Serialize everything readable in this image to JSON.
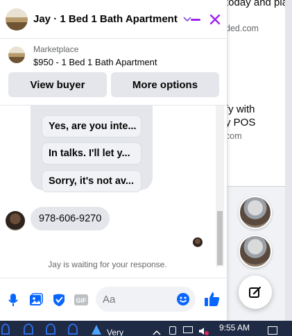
{
  "background": {
    "snippets": [
      "today and play",
      "ded.com",
      "fy with",
      "y POS",
      "com"
    ]
  },
  "chat": {
    "title": "Jay · 1 Bed 1 Bath Apartment",
    "chevron_icon": "chevron-down-icon",
    "accent": "#a020f0",
    "listing": {
      "category": "Marketplace",
      "title": "$950 - 1 Bed 1 Bath Apartment"
    },
    "buttons": {
      "view_buyer": "View buyer",
      "more_options": "More options"
    },
    "quick_replies": [
      "Yes, are you inte...",
      "In talks. I'll let y...",
      "Sorry, it's not av..."
    ],
    "message": "978-606-9270",
    "status": "Jay is waiting for your response.",
    "composer": {
      "placeholder": "Aa"
    }
  },
  "taskbar": {
    "weather_label": "Very",
    "time": "9:55 AM"
  }
}
